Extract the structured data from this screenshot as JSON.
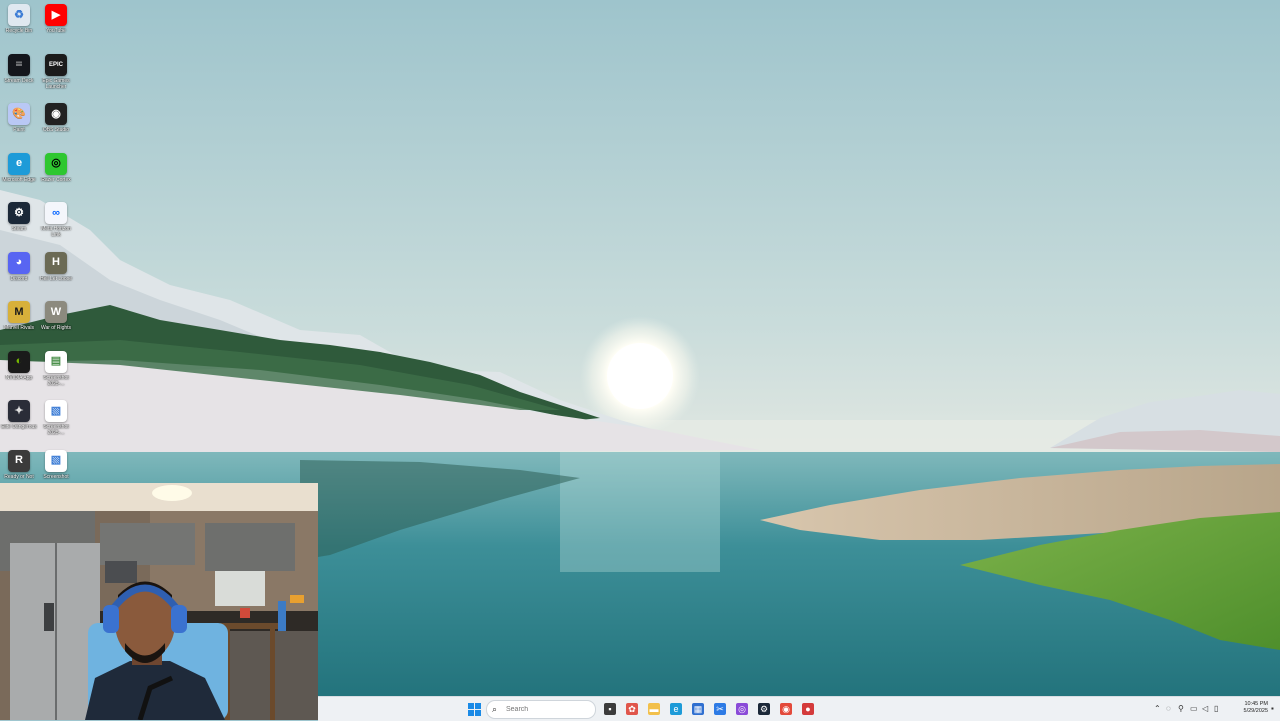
{
  "desktop": {
    "icons": [
      {
        "name": "recycle-bin",
        "label": "Recycle Bin",
        "glyph": "♻",
        "color": "#dfe8f0",
        "fg": "#3a7bd5"
      },
      {
        "name": "youtube",
        "label": "YouTube",
        "glyph": "▶",
        "color": "#ff0000",
        "fg": "#ffffff"
      },
      {
        "name": "streamdeck",
        "label": "Stream Deck",
        "glyph": "⁞⁞⁞",
        "color": "#14161c",
        "fg": "#ffffff"
      },
      {
        "name": "epic-games",
        "label": "Epic Games Launcher",
        "glyph": "EPIC",
        "color": "#1b1b1b",
        "fg": "#ffffff"
      },
      {
        "name": "paint",
        "label": "Paint",
        "glyph": "🎨",
        "color": "#b9c8f5",
        "fg": "#ffffff"
      },
      {
        "name": "obs-studio",
        "label": "OBS Studio",
        "glyph": "◉",
        "color": "#222222",
        "fg": "#ffffff"
      },
      {
        "name": "microsoft-edge",
        "label": "Microsoft Edge",
        "glyph": "e",
        "color": "#1d9bd8",
        "fg": "#ffffff"
      },
      {
        "name": "razer-cortex",
        "label": "Razer Cortex",
        "glyph": "◎",
        "color": "#2ec730",
        "fg": "#000000"
      },
      {
        "name": "steam",
        "label": "Steam",
        "glyph": "⚙",
        "color": "#1b2838",
        "fg": "#ffffff"
      },
      {
        "name": "meta-horizon",
        "label": "Meta Horizon Link",
        "glyph": "∞",
        "color": "#f4f6fb",
        "fg": "#0866ff"
      },
      {
        "name": "discord",
        "label": "Discord",
        "glyph": "◕",
        "color": "#5865f2",
        "fg": "#ffffff"
      },
      {
        "name": "hell-let-loose",
        "label": "Hell Let Loose",
        "glyph": "H",
        "color": "#6b6a55",
        "fg": "#ffffff"
      },
      {
        "name": "marvel-rivals",
        "label": "Marvel Rivals",
        "glyph": "M",
        "color": "#d7b03a",
        "fg": "#1a1a1a"
      },
      {
        "name": "war-of-rights",
        "label": "War of Rights",
        "glyph": "W",
        "color": "#8c8a7e",
        "fg": "#ffffff"
      },
      {
        "name": "nvidia",
        "label": "NVIDIA App",
        "glyph": "◐",
        "color": "#1a1a1a",
        "fg": "#76b900"
      },
      {
        "name": "screenshot-1",
        "label": "Screenshot 2025-...",
        "glyph": "▤",
        "color": "#ffffff",
        "fg": "#4a8f4a"
      },
      {
        "name": "elite-dangerous",
        "label": "Elite Dangerous",
        "glyph": "✦",
        "color": "#2a2d38",
        "fg": "#e0e0e0"
      },
      {
        "name": "screenshot-2",
        "label": "Screenshot 2025-...",
        "glyph": "▧",
        "color": "#ffffff",
        "fg": "#3a7bd5"
      },
      {
        "name": "ready-or-not",
        "label": "Ready or Not",
        "glyph": "R",
        "color": "#3b3b3b",
        "fg": "#ffffff"
      },
      {
        "name": "screenshot-3",
        "label": "Screenshot",
        "glyph": "▧",
        "color": "#ffffff",
        "fg": "#3a7bd5"
      }
    ]
  },
  "taskbar": {
    "search_placeholder": "Search",
    "search_icon": "search-icon",
    "start_icon": "windows-start-icon",
    "apps": [
      {
        "name": "task-view",
        "glyph": "▪",
        "color": "#3c3c3c"
      },
      {
        "name": "copilot",
        "glyph": "✿",
        "color": "#e0564b"
      },
      {
        "name": "file-explorer",
        "glyph": "▬",
        "color": "#f2c04b"
      },
      {
        "name": "microsoft-edge",
        "glyph": "e",
        "color": "#1d9bd8"
      },
      {
        "name": "microsoft-store",
        "glyph": "▦",
        "color": "#2f6fd0"
      },
      {
        "name": "snipping-tool",
        "glyph": "✂",
        "color": "#2d7be5"
      },
      {
        "name": "razer-synapse",
        "glyph": "◎",
        "color": "#8a4bd8"
      },
      {
        "name": "steam",
        "glyph": "⚙",
        "color": "#1b2838"
      },
      {
        "name": "chrome",
        "glyph": "◉",
        "color": "#e34a3b"
      },
      {
        "name": "obs-recording",
        "glyph": "●",
        "color": "#d43b3b"
      }
    ],
    "tray": {
      "overflow_icon": "chevron-up-icon",
      "clock_time": "10:45 PM",
      "clock_date": "5/29/2025"
    }
  }
}
